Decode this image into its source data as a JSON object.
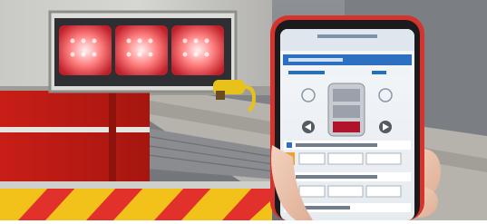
{
  "phone": {
    "header_text": "",
    "title_text": "",
    "section_label": "",
    "row1_text": "",
    "row2_text": ""
  },
  "colors": {
    "truck_red": "#d4261b",
    "truck_gray": "#b9b8b4",
    "stripe_yellow": "#f2c21b",
    "stripe_red": "#e2312a",
    "phone_case_red": "#d6332c",
    "screen_bg": "#eef3f8",
    "screen_header": "#2d6fc0",
    "lamp_glow": "#ff6a6a"
  }
}
